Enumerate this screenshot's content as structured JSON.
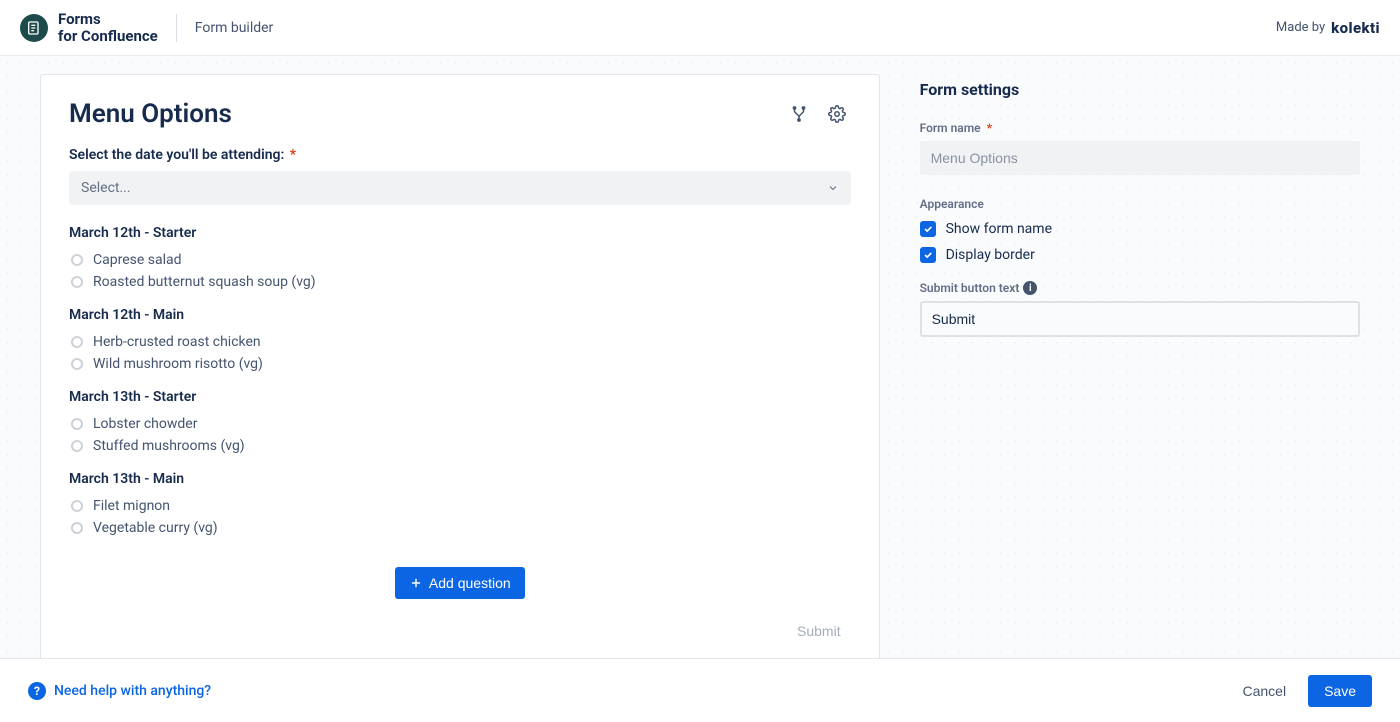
{
  "header": {
    "brand_l1": "Forms",
    "brand_l2": "for Confluence",
    "breadcrumb": "Form builder",
    "madeby_prefix": "Made by",
    "madeby_brand": "kolekti"
  },
  "form": {
    "title": "Menu Options",
    "questions": {
      "date": {
        "label": "Select the date you'll be attending:",
        "required": true,
        "placeholder": "Select..."
      }
    },
    "groups": [
      {
        "title": "March 12th - Starter",
        "options": [
          "Caprese salad",
          "Roasted butternut squash soup (vg)"
        ]
      },
      {
        "title": "March 12th - Main",
        "options": [
          "Herb-crusted roast chicken",
          "Wild mushroom risotto (vg)"
        ]
      },
      {
        "title": "March 13th - Starter",
        "options": [
          "Lobster chowder",
          "Stuffed mushrooms (vg)"
        ]
      },
      {
        "title": "March 13th - Main",
        "options": [
          "Filet mignon",
          "Vegetable curry (vg)"
        ]
      }
    ],
    "add_question_label": "Add question",
    "submit_preview_label": "Submit"
  },
  "settings": {
    "panel_title": "Form settings",
    "form_name_label": "Form name",
    "form_name_value": "Menu Options",
    "appearance_label": "Appearance",
    "show_form_name_label": "Show form name",
    "show_form_name_checked": true,
    "display_border_label": "Display border",
    "display_border_checked": true,
    "submit_text_label": "Submit button text",
    "submit_text_value": "Submit"
  },
  "footer": {
    "help_label": "Need help with anything?",
    "cancel_label": "Cancel",
    "save_label": "Save"
  }
}
